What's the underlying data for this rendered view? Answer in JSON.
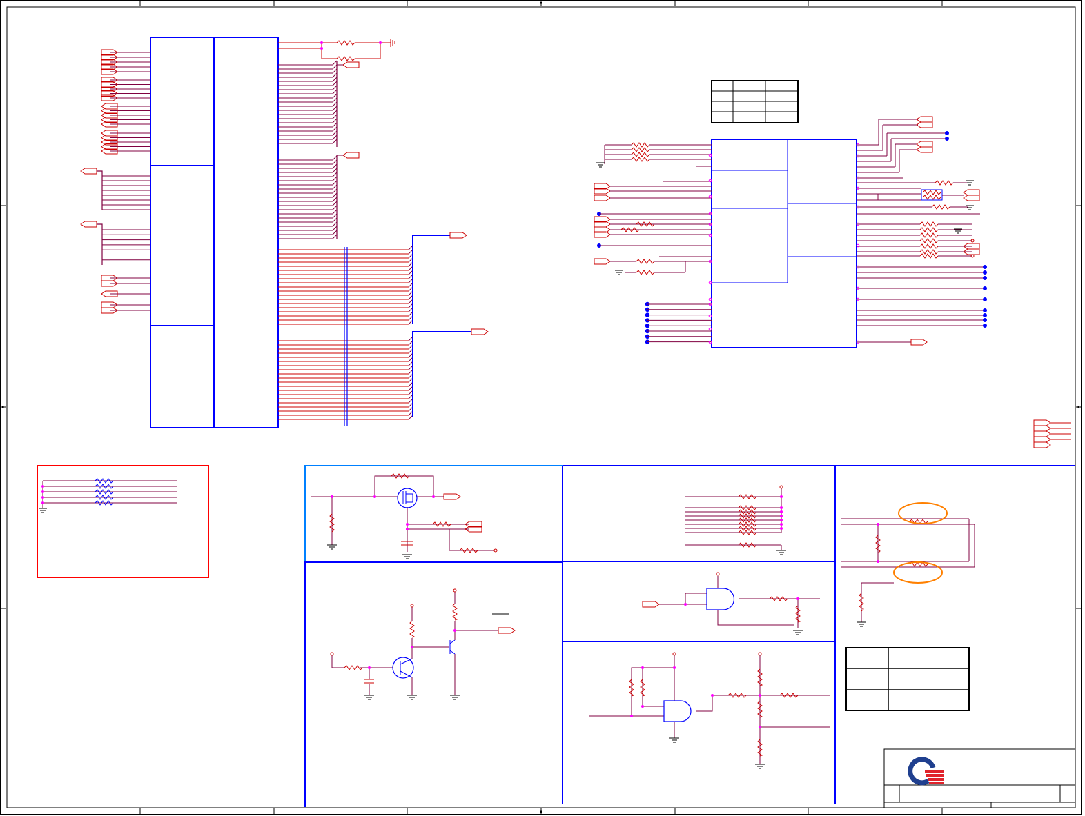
{
  "sheet": {
    "title": "",
    "colors": {
      "frame": "#000000",
      "block": "#0000ff",
      "section_light": "#0080ff",
      "wire": "#cc0000",
      "net_dark": "#800040",
      "junction": "#ff00ff",
      "highlight": "#ff8000",
      "note_box": "#ff0000",
      "logo_blue": "#1f3f8f",
      "logo_red": "#e0232b"
    }
  },
  "blocks": {
    "left_ic": "bga-ic-symbol",
    "right_ic": "interface-ic-symbol",
    "small_tables": "strap-option-tables"
  },
  "sections": [
    "note-box",
    "mosfet-switch",
    "pull-up-resistor-array",
    "series-resistor-pair",
    "transistor-driver",
    "and-gate-buffer",
    "and-gate-divider"
  ],
  "logo": {
    "icon": "company-logo-icon"
  }
}
